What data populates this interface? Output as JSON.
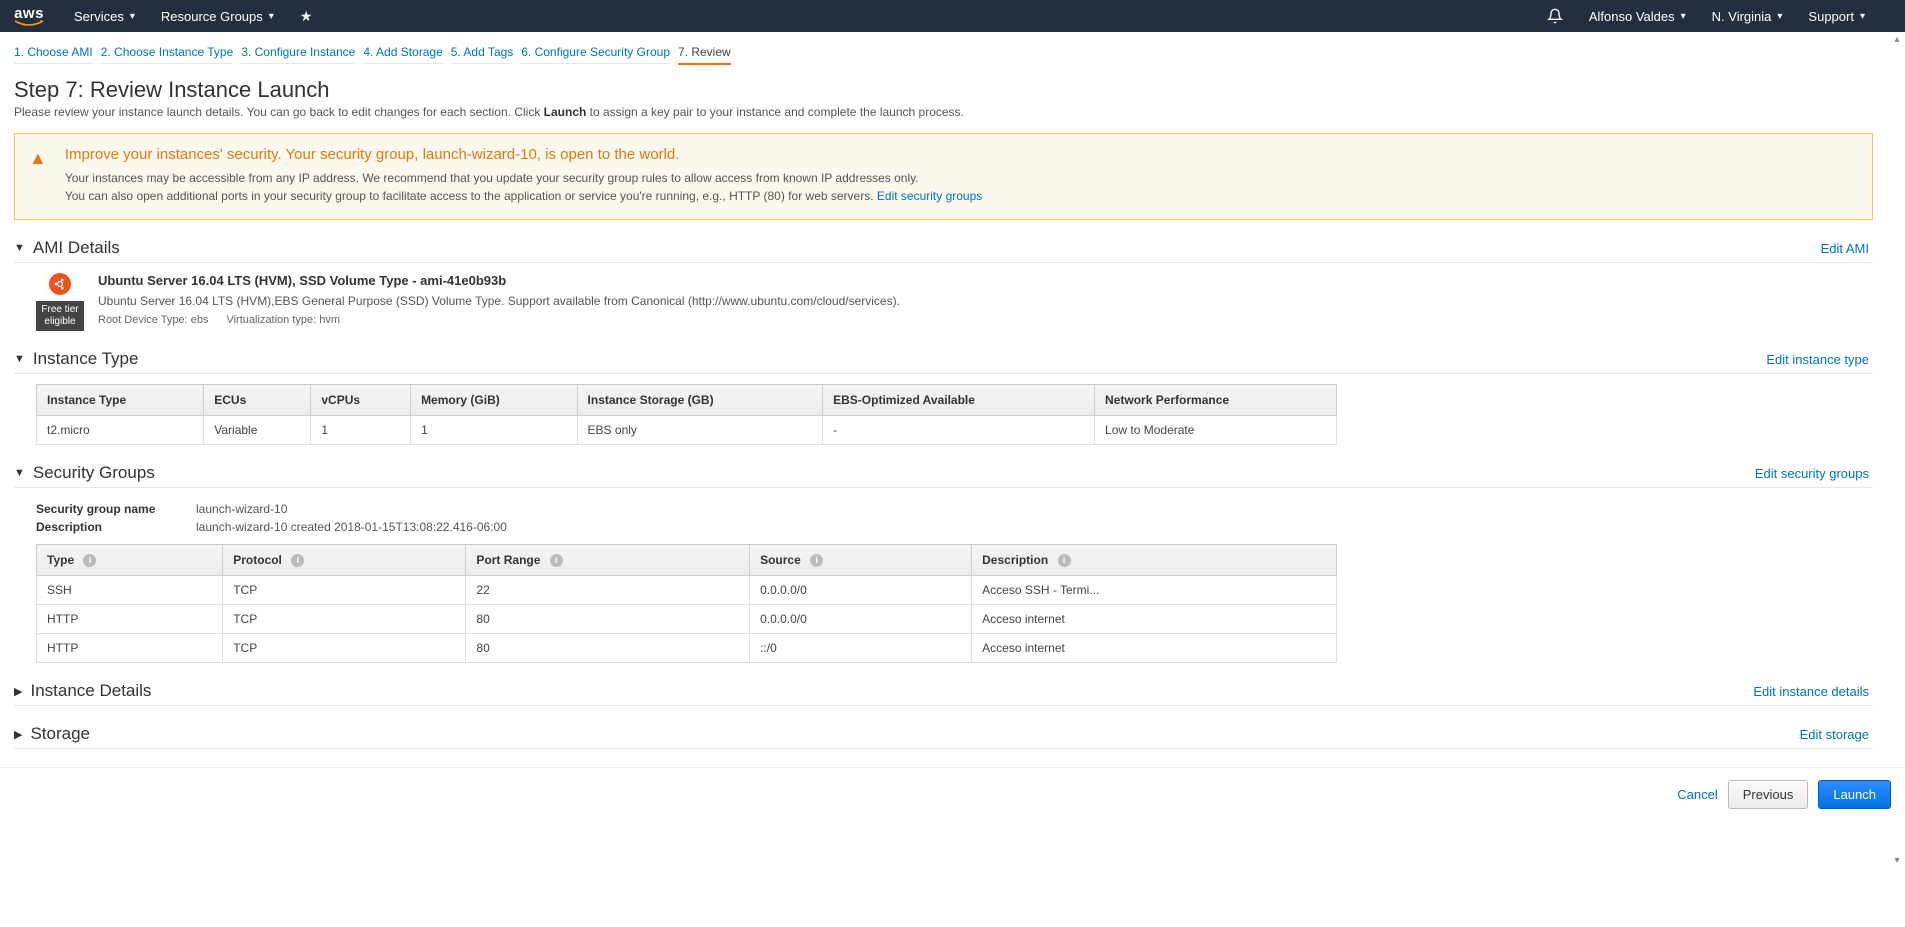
{
  "nav": {
    "logo": "aws",
    "services": "Services",
    "resource_groups": "Resource Groups",
    "user": "Alfonso Valdes",
    "region": "N. Virginia",
    "support": "Support"
  },
  "steps": [
    "1. Choose AMI",
    "2. Choose Instance Type",
    "3. Configure Instance",
    "4. Add Storage",
    "5. Add Tags",
    "6. Configure Security Group",
    "7. Review"
  ],
  "active_step": 6,
  "page": {
    "title": "Step 7: Review Instance Launch",
    "desc_a": "Please review your instance launch details. You can go back to edit changes for each section. Click ",
    "desc_b": "Launch",
    "desc_c": " to assign a key pair to your instance and complete the launch process."
  },
  "warning": {
    "title": "Improve your instances' security. Your security group, launch-wizard-10, is open to the world.",
    "line1": "Your instances may be accessible from any IP address. We recommend that you update your security group rules to allow access from known IP addresses only.",
    "line2": "You can also open additional ports in your security group to facilitate access to the application or service you're running, e.g., HTTP (80) for web servers. ",
    "link": "Edit security groups"
  },
  "ami": {
    "head": "AMI Details",
    "edit": "Edit AMI",
    "free_tier_a": "Free tier",
    "free_tier_b": "eligible",
    "title": "Ubuntu Server 16.04 LTS (HVM), SSD Volume Type - ami-41e0b93b",
    "desc": "Ubuntu Server 16.04 LTS (HVM),EBS General Purpose (SSD) Volume Type. Support available from Canonical (http://www.ubuntu.com/cloud/services).",
    "root": "Root Device Type: ebs",
    "virt": "Virtualization type: hvm"
  },
  "instance_type": {
    "head": "Instance Type",
    "edit": "Edit instance type",
    "cols": [
      "Instance Type",
      "ECUs",
      "vCPUs",
      "Memory (GiB)",
      "Instance Storage (GB)",
      "EBS-Optimized Available",
      "Network Performance"
    ],
    "row": [
      "t2.micro",
      "Variable",
      "1",
      "1",
      "EBS only",
      "-",
      "Low to Moderate"
    ]
  },
  "sg": {
    "head": "Security Groups",
    "edit": "Edit security groups",
    "name_label": "Security group name",
    "name_val": "launch-wizard-10",
    "desc_label": "Description",
    "desc_val": "launch-wizard-10 created 2018-01-15T13:08:22.416-06:00",
    "cols": [
      "Type",
      "Protocol",
      "Port Range",
      "Source",
      "Description"
    ],
    "rows": [
      [
        "SSH",
        "TCP",
        "22",
        "0.0.0.0/0",
        "Acceso SSH - Termi..."
      ],
      [
        "HTTP",
        "TCP",
        "80",
        "0.0.0.0/0",
        "Acceso internet"
      ],
      [
        "HTTP",
        "TCP",
        "80",
        "::/0",
        "Acceso internet"
      ]
    ]
  },
  "instance_details": {
    "head": "Instance Details",
    "edit": "Edit instance details"
  },
  "storage": {
    "head": "Storage",
    "edit": "Edit storage"
  },
  "footer": {
    "cancel": "Cancel",
    "previous": "Previous",
    "launch": "Launch"
  }
}
